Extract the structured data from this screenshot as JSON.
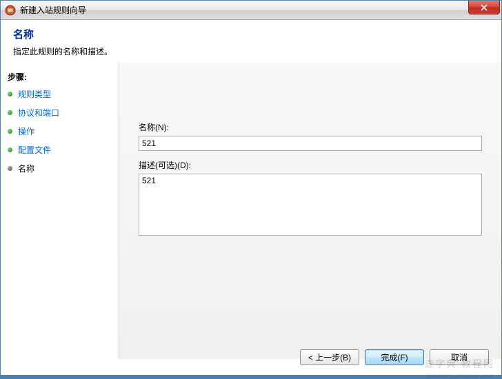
{
  "window": {
    "title": "新建入站规则向导"
  },
  "header": {
    "title": "名称",
    "desc": "指定此规则的名称和描述。"
  },
  "sidebar": {
    "steps_label": "步骤:",
    "items": [
      {
        "label": "规则类型",
        "current": false
      },
      {
        "label": "协议和端口",
        "current": false
      },
      {
        "label": "操作",
        "current": false
      },
      {
        "label": "配置文件",
        "current": false
      },
      {
        "label": "名称",
        "current": true
      }
    ]
  },
  "form": {
    "name_label": "名称(N):",
    "name_value": "521",
    "desc_label": "描述(可选)(D):",
    "desc_value": "521"
  },
  "buttons": {
    "back": "< 上一步(B)",
    "finish": "完成(F)",
    "cancel": "取消"
  },
  "watermark": {
    "main": "查字典 教程网",
    "sub": "jiaocheng.chazidian.com"
  }
}
